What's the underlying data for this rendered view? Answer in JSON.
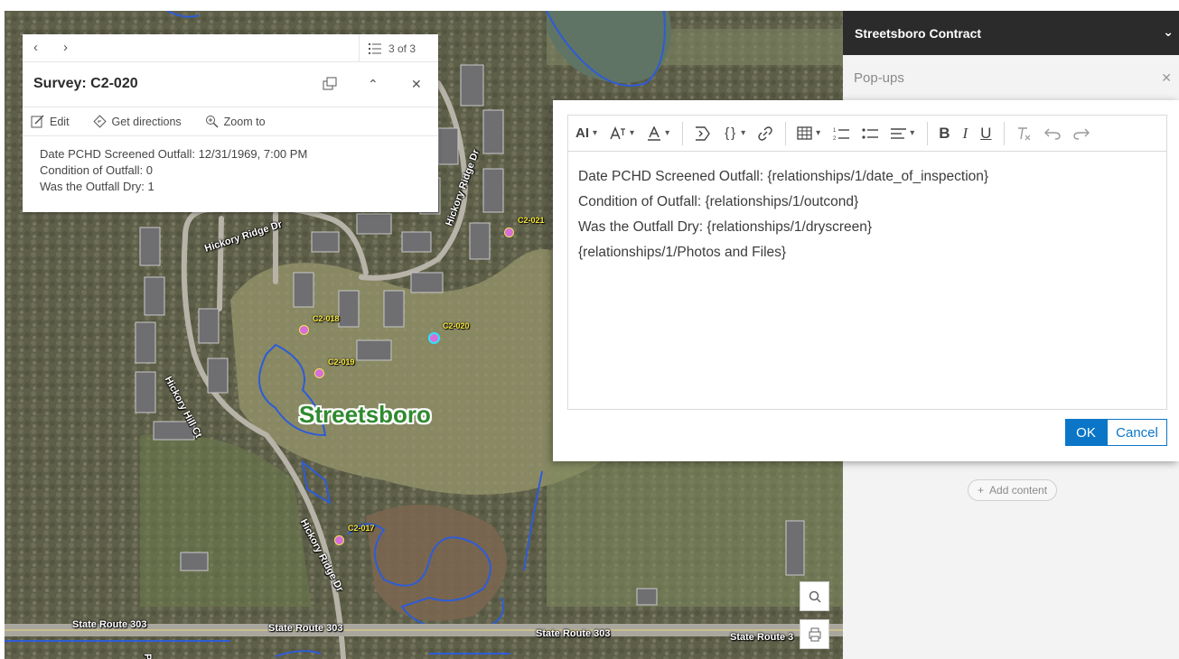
{
  "popup": {
    "pager": "3 of 3",
    "title": "Survey: C2-020",
    "actions": {
      "edit": "Edit",
      "directions": "Get directions",
      "zoom": "Zoom to"
    },
    "lines": [
      "Date PCHD Screened Outfall: 12/31/1969, 7:00 PM",
      "Condition of Outfall: 0",
      "Was the Outfall Dry: 1"
    ]
  },
  "map": {
    "town": "Streetsboro",
    "streets": {
      "hickory_ridge_1": "Hickory Ridge Dr",
      "hickory_ridge_2": "Hickory Ridge Dr",
      "hickory_ridge_3": "Hickory Ridge Dr",
      "hickory_hill": "Hickory Hill Ct",
      "sr303_1": "State Route 303",
      "sr303_2": "State Route 303",
      "sr303_3": "State Route 303",
      "sr303_4": "State Route 3",
      "partial": "Pa"
    },
    "markers": {
      "c2_021": "C2-021",
      "c2_018": "C2-018",
      "c2_019": "C2-019",
      "c2_020": "C2-020",
      "c2_017": "C2-017"
    },
    "colors": {
      "outfall_marker": "#d86ed8",
      "selected_ring": "#2fe3ff",
      "water_line": "#2e5cd6"
    }
  },
  "panel": {
    "title": "Streetsboro Contract",
    "section": "Pop-ups",
    "add_content": "Add content"
  },
  "editor": {
    "toolbar_icons": [
      "ai-assistant-icon",
      "font-size-icon",
      "font-color-icon",
      "insert-field-icon",
      "expression-icon",
      "link-icon",
      "table-icon",
      "numbered-list-icon",
      "bulleted-list-icon",
      "align-icon",
      "bold-icon",
      "italic-icon",
      "underline-icon",
      "clear-format-icon",
      "undo-icon",
      "redo-icon"
    ],
    "toolbar_text": {
      "ai": "AI",
      "bold": "B",
      "italic": "I",
      "underline": "U",
      "expression": "{}"
    },
    "lines": [
      "Date PCHD Screened Outfall: {relationships/1/date_of_inspection}",
      "Condition of Outfall: {relationships/1/outcond}",
      "Was the Outfall Dry: {relationships/1/dryscreen}",
      "{relationships/1/Photos and Files}"
    ],
    "ok": "OK",
    "cancel": "Cancel"
  }
}
